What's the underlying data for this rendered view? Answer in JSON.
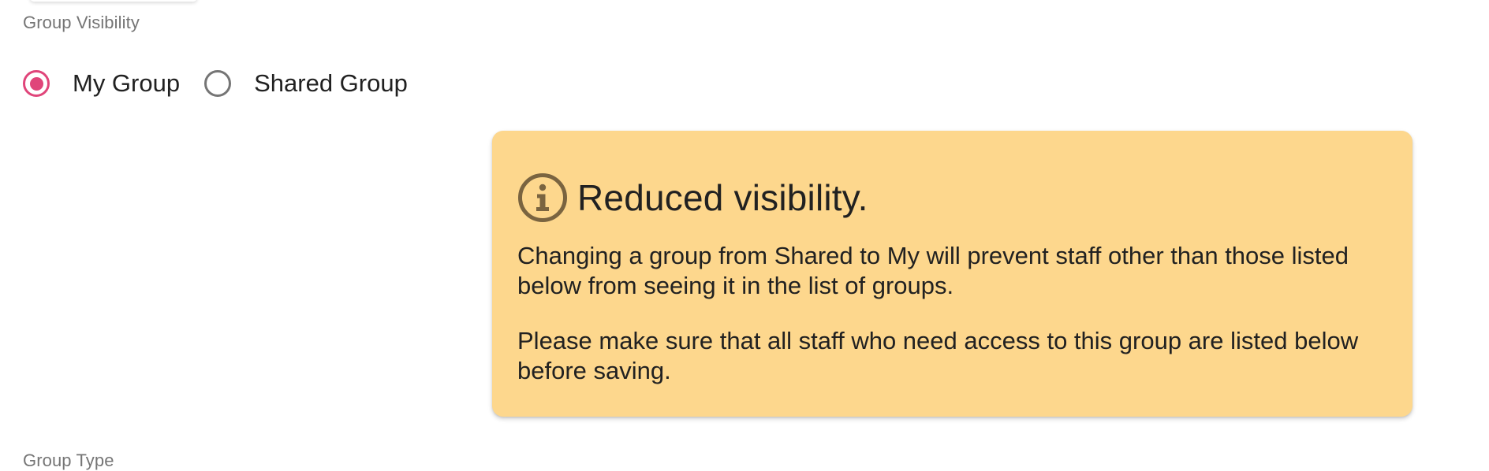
{
  "group_visibility": {
    "label": "Group Visibility",
    "options": [
      {
        "label": "My Group",
        "selected": true
      },
      {
        "label": "Shared Group",
        "selected": false
      }
    ],
    "accent_color": "#e0457a"
  },
  "alert": {
    "icon": "info-icon",
    "title": "Reduced visibility.",
    "paragraphs": [
      "Changing a group from Shared to My will prevent staff other than those listed below from seeing it in the list of groups.",
      "Please make sure that all staff who need access to this group are listed below before saving."
    ],
    "background_color": "#fdd78d",
    "icon_color": "#7a6440"
  },
  "group_type": {
    "label": "Group Type"
  }
}
